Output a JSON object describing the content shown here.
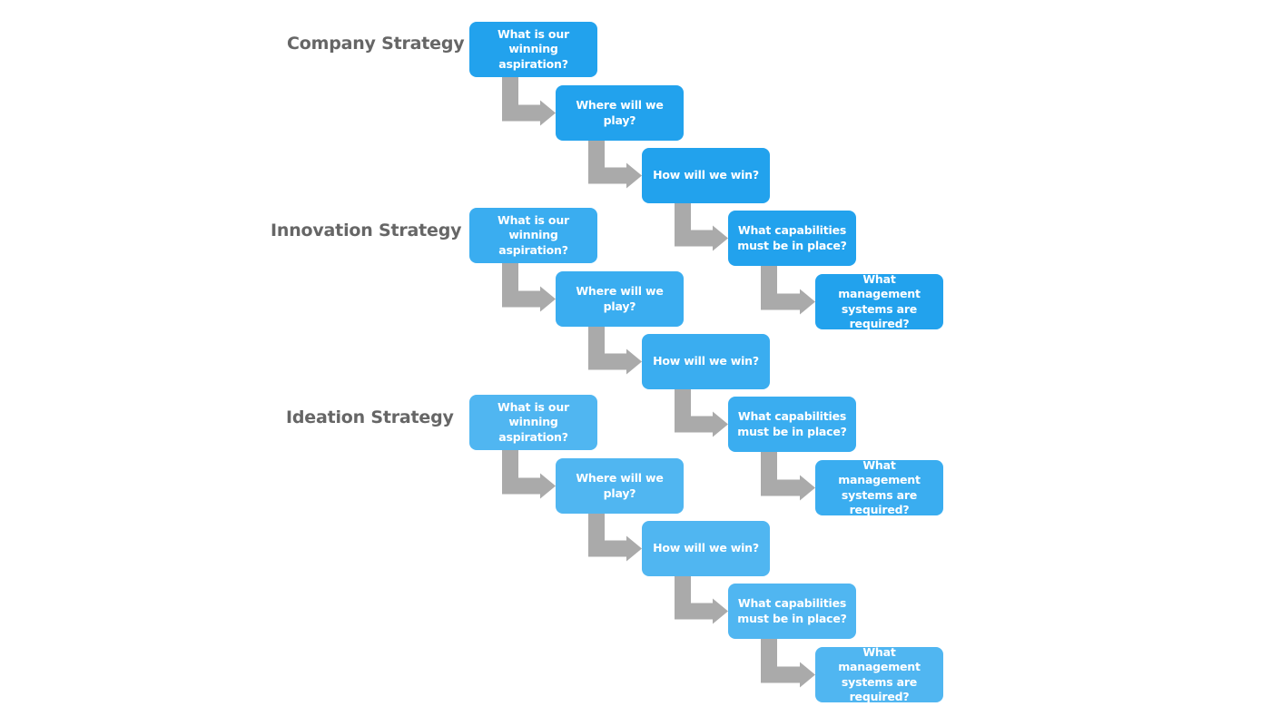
{
  "diagram": {
    "arrow_color": "#aaaaaa",
    "label_color": "#666666",
    "tiers": [
      {
        "label": "Company Strategy",
        "color": "#22a2ed",
        "steps": [
          "What is our winning aspiration?",
          "Where will we play?",
          "How will we win?",
          "What capabilities must be in place?",
          "What management systems are required?"
        ]
      },
      {
        "label": "Innovation Strategy",
        "color": "#3aadf0",
        "steps": [
          "What is our winning aspiration?",
          "Where will we play?",
          "How will we win?",
          "What capabilities must be in place?",
          "What management systems are required?"
        ]
      },
      {
        "label": "Ideation Strategy",
        "color": "#50b6f1",
        "steps": [
          "What is our winning aspiration?",
          "Where will we play?",
          "How will we win?",
          "What capabilities must be in place?",
          "What management systems are required?"
        ]
      }
    ]
  }
}
